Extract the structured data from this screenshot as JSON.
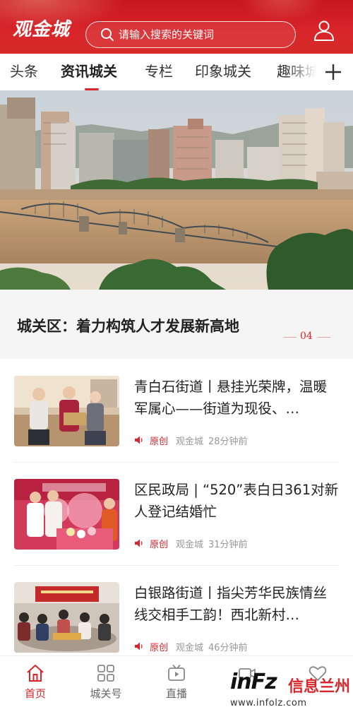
{
  "app": {
    "logo_text": "观金城",
    "search_placeholder": "请输入搜索的关键词",
    "colors": {
      "brand_red": "#d9262b",
      "text_dark": "#222222",
      "text_muted": "#999999"
    }
  },
  "tabs": [
    {
      "label": "头条",
      "active": false
    },
    {
      "label": "资讯城关",
      "active": true
    },
    {
      "label": "专栏",
      "active": false
    },
    {
      "label": "印象城关",
      "active": false
    },
    {
      "label": "趣味城",
      "active": false
    }
  ],
  "banner": {
    "title": "城关区：着力构筑人才发展新高地",
    "index": "04",
    "image": "city-river-bridge-photo"
  },
  "news": [
    {
      "title": "青白石街道丨悬挂光荣牌，温暖军属心——街道为现役、…",
      "tag": "原创",
      "source": "观金城",
      "time": "28分钟前",
      "image": "family-photo-thumbnail"
    },
    {
      "title": "区民政局 | “520”表白日361对新人登记结婚忙",
      "tag": "原创",
      "source": "观金城",
      "time": "31分钟前",
      "image": "wedding-registration-thumbnail"
    },
    {
      "title": "白银路街道丨指尖芳华民族情丝线交相手工韵！西北新村…",
      "tag": "原创",
      "source": "观金城",
      "time": "46分钟前",
      "image": "handcraft-class-thumbnail"
    }
  ],
  "bottom_nav": [
    {
      "label": "首页",
      "icon": "home-icon",
      "active": true
    },
    {
      "label": "城关号",
      "icon": "grid-icon",
      "active": false
    },
    {
      "label": "直播",
      "icon": "tv-icon",
      "active": false
    },
    {
      "label": "",
      "icon": "video-icon",
      "active": false
    },
    {
      "label": "",
      "icon": "heart-icon",
      "active": false
    }
  ],
  "watermark": {
    "brand": "inFz",
    "name": "信息兰州",
    "url": "www.infolz.com"
  }
}
